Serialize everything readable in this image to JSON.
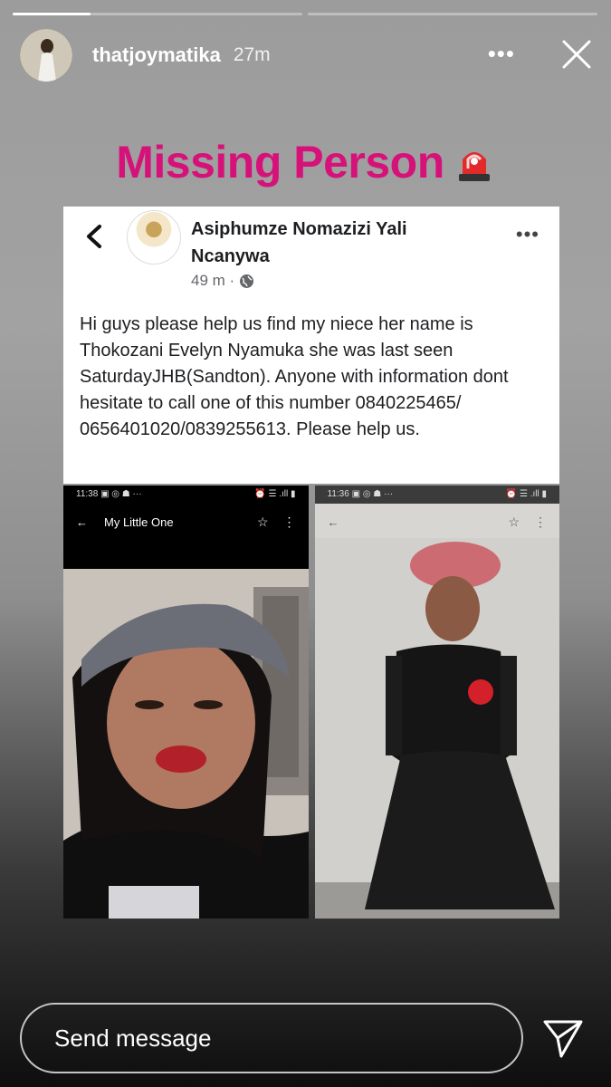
{
  "story": {
    "username": "thatjoymatika",
    "time": "27m",
    "more_label": "•••",
    "progress": [
      1.0,
      0.0
    ],
    "title": "Missing Person"
  },
  "post": {
    "author": "Asiphumze Nomazizi Yali Ncanywa",
    "meta_time": "49 m ·",
    "more_label": "•••",
    "text": "Hi guys please help us find my niece her name is Thokozani Evelyn Nyamuka she was last seen SaturdayJHB(Sandton). Anyone with information dont hesitate to call one of this number 0840225465/ 0656401020/0839255613. Please help us."
  },
  "photos": {
    "left": {
      "status_time": "11:38",
      "status_icons_left": "▣ ◎ ☗  ···",
      "status_icons_right": "⏰ ☰ .ıll ▮",
      "title": "My Little One",
      "back": "←",
      "star": "☆",
      "menu": "⋮"
    },
    "right": {
      "status_time": "11:36",
      "status_icons_left": "▣ ◎ ☗  ···",
      "status_icons_right": "⏰ ☰ .ıll ▮",
      "back": "←",
      "star": "☆",
      "menu": "⋮"
    }
  },
  "composer": {
    "placeholder": "Send message"
  },
  "icons": {
    "close": "close-icon",
    "send": "send-icon",
    "siren": "siren-icon",
    "globe": "globe-icon",
    "back": "chevron-left-icon"
  },
  "colors": {
    "title": "#d6127a",
    "meta": "#65676b"
  }
}
